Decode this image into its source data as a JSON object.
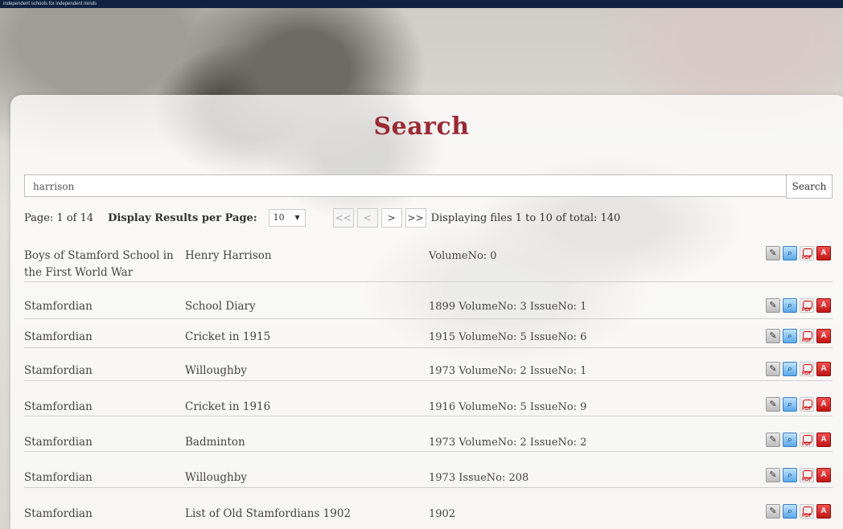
{
  "header": {
    "tagline": "independent schools for independent minds"
  },
  "page_title": "Search",
  "search": {
    "value": "harrison",
    "button_label": "Search"
  },
  "pager": {
    "page_info": "Page: 1 of 14",
    "per_page_label": "Display Results per Page:",
    "per_page_value": "10",
    "first_label": "<<",
    "prev_label": "<",
    "next_label": ">",
    "last_label": ">>",
    "displaying": "Displaying files 1 to 10 of total: 140"
  },
  "results": [
    {
      "publication": "Boys of Stamford School in the First World War",
      "title": "Henry Harrison",
      "details": "VolumeNo: 0"
    },
    {
      "publication": "Stamfordian",
      "title": "School Diary",
      "details": "1899 VolumeNo: 3 IssueNo: 1"
    },
    {
      "publication": "Stamfordian",
      "title": "Cricket in 1915",
      "details": "1915 VolumeNo: 5 IssueNo: 6"
    },
    {
      "publication": "Stamfordian",
      "title": "Willoughby",
      "details": "1973 VolumeNo: 2 IssueNo: 1"
    },
    {
      "publication": "Stamfordian",
      "title": "Cricket in 1916",
      "details": "1916 VolumeNo: 5 IssueNo: 9"
    },
    {
      "publication": "Stamfordian",
      "title": "Badminton",
      "details": "1973 VolumeNo: 2 IssueNo: 2"
    },
    {
      "publication": "Stamfordian",
      "title": "Willoughby",
      "details": "1973 IssueNo: 208"
    },
    {
      "publication": "Stamfordian",
      "title": "List of Old Stamfordians 1902",
      "details": "1902"
    }
  ],
  "icons": {
    "edit": "pencil-icon",
    "view": "magnifier-icon",
    "pdf": "pdf-file-icon",
    "acrobat": "acrobat-icon",
    "pdf_text": "PDF",
    "select_arrow": "▼"
  },
  "colors": {
    "accent": "#9b2a35",
    "topbar": "#0f2340"
  }
}
